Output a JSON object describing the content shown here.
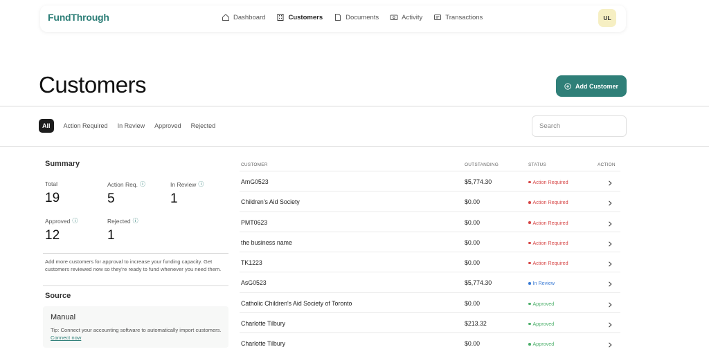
{
  "brand": "FundThrough",
  "nav": [
    {
      "label": "Dashboard",
      "icon": "home-icon",
      "active": false
    },
    {
      "label": "Customers",
      "icon": "building-icon",
      "active": true
    },
    {
      "label": "Documents",
      "icon": "document-icon",
      "active": false
    },
    {
      "label": "Activity",
      "icon": "activity-icon",
      "active": false
    },
    {
      "label": "Transactions",
      "icon": "transactions-icon",
      "active": false
    }
  ],
  "user_initials": "UL",
  "page_title": "Customers",
  "add_button_label": "Add Customer",
  "filters": [
    "All",
    "Action Required",
    "In Review",
    "Approved",
    "Rejected"
  ],
  "active_filter": "All",
  "search_placeholder": "Search",
  "summary": {
    "title": "Summary",
    "stats": [
      {
        "label": "Total",
        "value": "19",
        "info": false
      },
      {
        "label": "Action Req.",
        "value": "5",
        "info": true
      },
      {
        "label": "In Review",
        "value": "1",
        "info": true
      },
      {
        "label": "Approved",
        "value": "12",
        "info": true
      },
      {
        "label": "Rejected",
        "value": "1",
        "info": true
      }
    ],
    "note": "Add more customers for approval to increase your funding capacity. Get customers reviewed now so they're ready to fund whenever you need them."
  },
  "source": {
    "title": "Source",
    "manual_title": "Manual",
    "tip": "Tip: Connect your accounting software to automatically import customers.",
    "link": "Connect now"
  },
  "table": {
    "columns": {
      "customer": "CUSTOMER",
      "outstanding": "OUTSTANDING",
      "status": "STATUS",
      "action": "ACTION"
    },
    "rows": [
      {
        "customer": "AmG0523",
        "outstanding": "$5,774.30",
        "status": "Action Required"
      },
      {
        "customer": "Children's Aid Society",
        "outstanding": "$0.00",
        "status": "Action Required"
      },
      {
        "customer": "PMT0623",
        "outstanding": "$0.00",
        "status": "Action Required"
      },
      {
        "customer": "the business name",
        "outstanding": "$0.00",
        "status": "Action Required"
      },
      {
        "customer": "TK1223",
        "outstanding": "$0.00",
        "status": "Action Required"
      },
      {
        "customer": "AsG0523",
        "outstanding": "$5,774.30",
        "status": "In Review"
      },
      {
        "customer": "Catholic Children's Aid Society of Toronto",
        "outstanding": "$0.00",
        "status": "Approved"
      },
      {
        "customer": "Charlotte Tilbury",
        "outstanding": "$213.32",
        "status": "Approved"
      },
      {
        "customer": "Charlotte Tilbury",
        "outstanding": "$0.00",
        "status": "Approved"
      }
    ]
  },
  "status_colors": {
    "Action Required": "#d64545",
    "In Review": "#3a7bd5",
    "Approved": "#4caf6a"
  },
  "accent_color": "#2f7f78"
}
